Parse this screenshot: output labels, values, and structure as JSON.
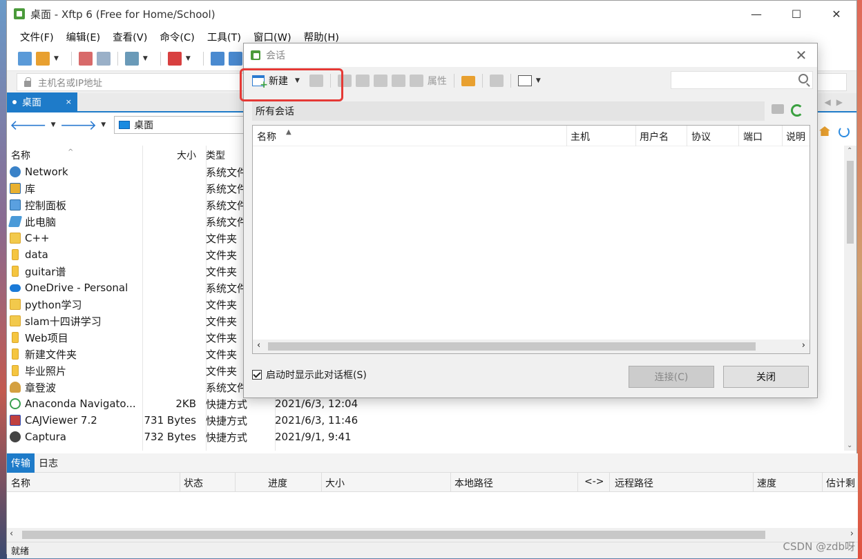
{
  "window": {
    "title": "桌面 - Xftp 6 (Free for Home/School)",
    "controls": {
      "minimize": "—",
      "maximize": "☐",
      "close": "✕"
    }
  },
  "menu": [
    "文件(F)",
    "编辑(E)",
    "查看(V)",
    "命令(C)",
    "工具(T)",
    "窗口(W)",
    "帮助(H)"
  ],
  "address": {
    "placeholder": "主机名或IP地址"
  },
  "tab": {
    "label": "桌面",
    "close": "×"
  },
  "path": {
    "current": "桌面"
  },
  "filelist": {
    "columns": {
      "name": "名称",
      "size": "大小",
      "type": "类型"
    },
    "rows": [
      {
        "name": "Network",
        "size": "",
        "type": "系统文件",
        "date": "",
        "icon": "network-icon"
      },
      {
        "name": "库",
        "size": "",
        "type": "系统文件",
        "date": "",
        "icon": "library-icon"
      },
      {
        "name": "控制面板",
        "size": "",
        "type": "系统文件",
        "date": "",
        "icon": "control-panel-icon"
      },
      {
        "name": "此电脑",
        "size": "",
        "type": "系统文件",
        "date": "",
        "icon": "computer-icon"
      },
      {
        "name": "C++",
        "size": "",
        "type": "文件夹",
        "date": "",
        "icon": "folder-icon"
      },
      {
        "name": "data",
        "size": "",
        "type": "文件夹",
        "date": "",
        "icon": "folder-icon"
      },
      {
        "name": "guitar谱",
        "size": "",
        "type": "文件夹",
        "date": "",
        "icon": "folder-icon"
      },
      {
        "name": "OneDrive - Personal",
        "size": "",
        "type": "系统文件",
        "date": "",
        "icon": "onedrive-icon"
      },
      {
        "name": "python学习",
        "size": "",
        "type": "文件夹",
        "date": "",
        "icon": "folder-icon"
      },
      {
        "name": "slam十四讲学习",
        "size": "",
        "type": "文件夹",
        "date": "",
        "icon": "folder-icon"
      },
      {
        "name": "Web项目",
        "size": "",
        "type": "文件夹",
        "date": "",
        "icon": "folder-icon"
      },
      {
        "name": "新建文件夹",
        "size": "",
        "type": "文件夹",
        "date": "",
        "icon": "folder-icon"
      },
      {
        "name": "毕业照片",
        "size": "",
        "type": "文件夹",
        "date": "",
        "icon": "folder-icon"
      },
      {
        "name": "章登波",
        "size": "",
        "type": "系统文件",
        "date": "",
        "icon": "user-folder-icon"
      },
      {
        "name": "Anaconda Navigato...",
        "size": "2KB",
        "type": "快捷方式",
        "date": "2021/6/3, 12:04",
        "icon": "anaconda-icon"
      },
      {
        "name": "CAJViewer 7.2",
        "size": "731 Bytes",
        "type": "快捷方式",
        "date": "2021/6/3, 11:46",
        "icon": "cajviewer-icon"
      },
      {
        "name": "Captura",
        "size": "732 Bytes",
        "type": "快捷方式",
        "date": "2021/9/1, 9:41",
        "icon": "captura-icon"
      }
    ]
  },
  "transfer": {
    "tabs": [
      "传输",
      "日志"
    ],
    "columns": [
      "名称",
      "状态",
      "进度",
      "大小",
      "本地路径",
      "<->",
      "远程路径",
      "速度",
      "估计剩"
    ]
  },
  "status": {
    "text": "就绪"
  },
  "dialog": {
    "title": "会话",
    "close": "✕",
    "toolbar": {
      "new_label": "新建",
      "properties_label": "属性"
    },
    "path": "所有会话",
    "columns": [
      "名称",
      "主机",
      "用户名",
      "协议",
      "端口",
      "说明"
    ],
    "show_on_startup": "启动时显示此对话框(S)",
    "connect_button": "连接(C)",
    "close_button": "关闭"
  },
  "watermark": "CSDN @zdb呀"
}
